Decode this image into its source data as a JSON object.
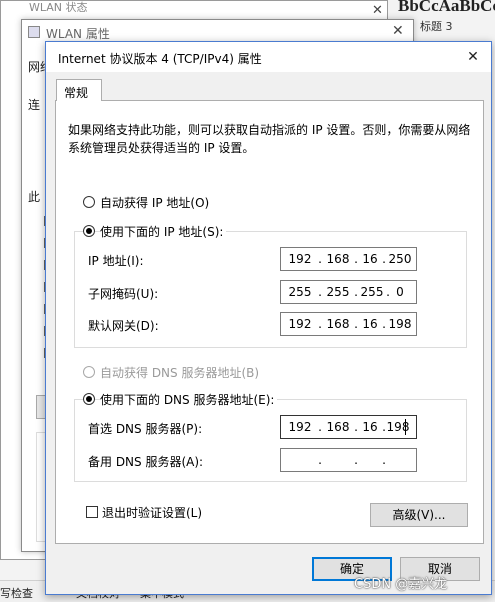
{
  "background_app": {
    "ribbon_text": "BbCcAaBbCc",
    "style_label": "标题 3",
    "style_label_left": "",
    "status": {
      "item1": "写检查",
      "item2": "文档校对",
      "item3": "集中模式"
    }
  },
  "wlan_status_window": {
    "title": "WLAN 状态"
  },
  "wlan_properties_window": {
    "title": "WLAN 属性",
    "fragments": [
      "网络",
      "连",
      "此"
    ]
  },
  "dialog": {
    "title": "Internet 协议版本 4 (TCP/IPv4) 属性",
    "close_glyph": "✕",
    "tab_label": "常规",
    "description": "如果网络支持此功能，则可以获取自动指派的 IP 设置。否则，你需要从网络系统管理员处获得适当的 IP 设置。",
    "auto_ip_label": "自动获得 IP 地址(O)",
    "manual_ip_label": "使用下面的 IP 地址(S):",
    "ip_address_label": "IP 地址(I):",
    "ip_address": [
      "192",
      "168",
      "16",
      "250"
    ],
    "subnet_label": "子网掩码(U):",
    "subnet_mask": [
      "255",
      "255",
      "255",
      "0"
    ],
    "gateway_label": "默认网关(D):",
    "gateway": [
      "192",
      "168",
      "16",
      "198"
    ],
    "auto_dns_label": "自动获得 DNS 服务器地址(B)",
    "manual_dns_label": "使用下面的 DNS 服务器地址(E):",
    "preferred_dns_label": "首选 DNS 服务器(P):",
    "preferred_dns": [
      "192",
      "168",
      "16",
      "198"
    ],
    "alternate_dns_label": "备用 DNS 服务器(A):",
    "alternate_dns": [
      "",
      "",
      "",
      ""
    ],
    "validate_label": "退出时验证设置(L)",
    "advanced_button": "高级(V)...",
    "ok_button": "确定",
    "cancel_button": "取消",
    "selected_ip_mode": "manual",
    "selected_dns_mode": "manual",
    "validate_checked": false
  },
  "watermark": "CSDN @嘉兴龙"
}
